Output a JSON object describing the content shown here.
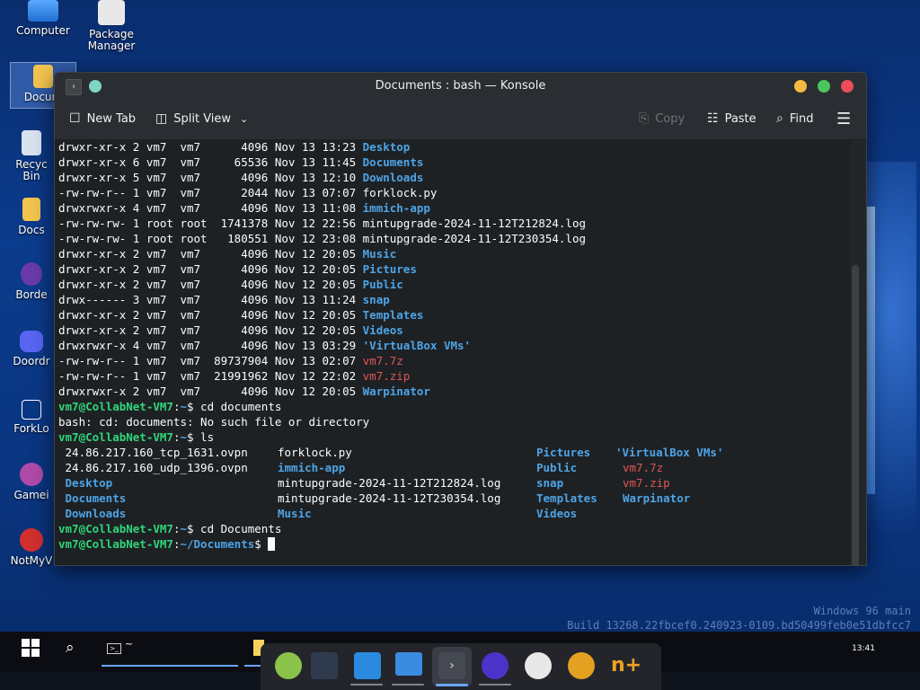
{
  "desktop": {
    "icons": [
      {
        "label": "Computer"
      },
      {
        "label": "Package Manager"
      },
      {
        "label": "Docum"
      },
      {
        "label": "Recyc Bin"
      },
      {
        "label": "Docs"
      },
      {
        "label": "Borde"
      },
      {
        "label": "Doordr"
      },
      {
        "label": "ForkLo"
      },
      {
        "label": "Gamei"
      },
      {
        "label": "NotMyV"
      }
    ],
    "watermark_line1": "Windows 96 main",
    "watermark_line2": "Build 13268.22fbcef0.240923-0109.bd50499feb0e51dbfcc7"
  },
  "window": {
    "title": "Documents : bash — Konsole",
    "toolbar": {
      "new_tab": "New Tab",
      "split_view": "Split View",
      "copy": "Copy",
      "paste": "Paste",
      "find": "Find"
    }
  },
  "terminal": {
    "listing": [
      {
        "perm": "drwxr-xr-x 2 vm7  vm7      4096 Nov 13 13:23 ",
        "name": "Desktop",
        "kind": "dir"
      },
      {
        "perm": "drwxr-xr-x 6 vm7  vm7     65536 Nov 13 11:45 ",
        "name": "Documents",
        "kind": "dir"
      },
      {
        "perm": "drwxr-xr-x 5 vm7  vm7      4096 Nov 13 12:10 ",
        "name": "Downloads",
        "kind": "dir"
      },
      {
        "perm": "-rw-rw-r-- 1 vm7  vm7      2044 Nov 13 07:07 ",
        "name": "forklock.py",
        "kind": "file"
      },
      {
        "perm": "drwxrwxr-x 4 vm7  vm7      4096 Nov 13 11:08 ",
        "name": "immich-app",
        "kind": "dir"
      },
      {
        "perm": "-rw-rw-rw- 1 root root  1741378 Nov 12 22:56 ",
        "name": "mintupgrade-2024-11-12T212824.log",
        "kind": "file"
      },
      {
        "perm": "-rw-rw-rw- 1 root root   180551 Nov 12 23:08 ",
        "name": "mintupgrade-2024-11-12T230354.log",
        "kind": "file"
      },
      {
        "perm": "drwxr-xr-x 2 vm7  vm7      4096 Nov 12 20:05 ",
        "name": "Music",
        "kind": "dir"
      },
      {
        "perm": "drwxr-xr-x 2 vm7  vm7      4096 Nov 12 20:05 ",
        "name": "Pictures",
        "kind": "dir"
      },
      {
        "perm": "drwxr-xr-x 2 vm7  vm7      4096 Nov 12 20:05 ",
        "name": "Public",
        "kind": "dir"
      },
      {
        "perm": "drwx------ 3 vm7  vm7      4096 Nov 13 11:24 ",
        "name": "snap",
        "kind": "dir"
      },
      {
        "perm": "drwxr-xr-x 2 vm7  vm7      4096 Nov 12 20:05 ",
        "name": "Templates",
        "kind": "dir"
      },
      {
        "perm": "drwxr-xr-x 2 vm7  vm7      4096 Nov 12 20:05 ",
        "name": "Videos",
        "kind": "dir"
      },
      {
        "perm": "drwxrwxr-x 4 vm7  vm7      4096 Nov 13 03:29 ",
        "name": "'VirtualBox VMs'",
        "kind": "dir"
      },
      {
        "perm": "-rw-rw-r-- 1 vm7  vm7  89737904 Nov 13 02:07 ",
        "name": "vm7.7z",
        "kind": "arch"
      },
      {
        "perm": "-rw-rw-r-- 1 vm7  vm7  21991962 Nov 12 22:02 ",
        "name": "vm7.zip",
        "kind": "arch"
      },
      {
        "perm": "drwxrwxr-x 2 vm7  vm7      4096 Nov 12 20:05 ",
        "name": "Warpinator",
        "kind": "dir"
      }
    ],
    "prompt_user": "vm7@CollabNet-VM7",
    "prompt_path": "~",
    "prompt_path_docs": "~/Documents",
    "cmd1": " cd documents",
    "error1": "bash: cd: documents: No such file or directory",
    "cmd2": " ls",
    "cmd3": " cd Documents",
    "ls_rows": [
      [
        {
          "t": " 24.86.217.160_tcp_1631.ovpn",
          "k": "file"
        },
        {
          "t": "forklock.py",
          "k": "file"
        },
        {
          "t": "Pictures",
          "k": "dir"
        },
        {
          "t": "'VirtualBox VMs'",
          "k": "dir"
        }
      ],
      [
        {
          "t": " 24.86.217.160_udp_1396.ovpn",
          "k": "file"
        },
        {
          "t": "immich-app",
          "k": "dir"
        },
        {
          "t": "Public",
          "k": "dir"
        },
        {
          "t": "vm7.7z",
          "k": "arch"
        }
      ],
      [
        {
          "t": " Desktop",
          "k": "dir"
        },
        {
          "t": "mintupgrade-2024-11-12T212824.log",
          "k": "file"
        },
        {
          "t": "snap",
          "k": "dir"
        },
        {
          "t": "vm7.zip",
          "k": "arch"
        }
      ],
      [
        {
          "t": " Documents",
          "k": "dir"
        },
        {
          "t": "mintupgrade-2024-11-12T230354.log",
          "k": "file"
        },
        {
          "t": "Templates",
          "k": "dir"
        },
        {
          "t": "Warpinator",
          "k": "dir"
        }
      ],
      [
        {
          "t": " Downloads",
          "k": "dir"
        },
        {
          "t": "Music",
          "k": "dir"
        },
        {
          "t": "Videos",
          "k": "dir"
        },
        {
          "t": "",
          "k": "file"
        }
      ]
    ]
  },
  "taskbar": {
    "konsole_label": "~",
    "clock": "13:41"
  },
  "colors": {
    "dir": "#4ea4e6",
    "archive": "#e05555",
    "prompt": "#2fd67a",
    "terminal_bg": "#1e2124"
  }
}
